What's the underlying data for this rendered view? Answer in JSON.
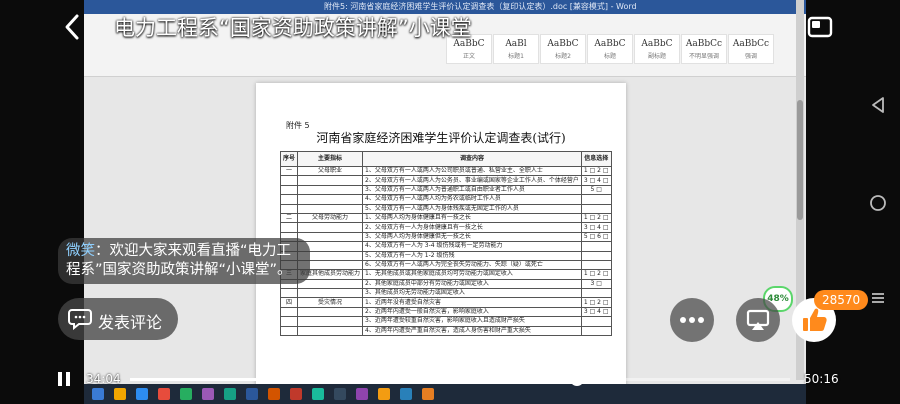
{
  "header": {
    "title": "电力工程系“国家资助政策讲解”小课堂"
  },
  "word": {
    "window_title": "附件5: 河南省家庭经济困难学生评价认定调查表（复印认定表）.doc [兼容模式] - Word",
    "styles": [
      {
        "preview": "AaBbC",
        "name": "正文"
      },
      {
        "preview": "AaBl",
        "name": "标题1"
      },
      {
        "preview": "AaBbC",
        "name": "标题2"
      },
      {
        "preview": "AaBbC",
        "name": "标题"
      },
      {
        "preview": "AaBbC",
        "name": "副标题"
      },
      {
        "preview": "AaBbCc",
        "name": "不明显强调"
      },
      {
        "preview": "AaBbCc",
        "name": "强调"
      }
    ],
    "document": {
      "annex_label": "附件 5",
      "title": "河南省家庭经济困难学生评价认定调查表(试行)",
      "columns": {
        "index": "序号",
        "indicator": "主要指标",
        "content": "调查内容",
        "option": "信息选择"
      },
      "rows": [
        {
          "index": "一",
          "indicator": "父母职业",
          "content": "1、父母双方有一人或两人为公司职员或普通、私营业主、全职人士",
          "option": "1 □ 2 □"
        },
        {
          "index": "",
          "indicator": "",
          "content": "2、父母双方有一人或两人为公务员、事业编或国家等企业工作人员、个体经营户",
          "option": "3 □ 4 □"
        },
        {
          "index": "",
          "indicator": "",
          "content": "3、父母双方有一人或两人为普通职工或自由职业者工作人员",
          "option": "5 □"
        },
        {
          "index": "",
          "indicator": "",
          "content": "4、父母双方有一人或两人均为务农或临时工作人员",
          "option": ""
        },
        {
          "index": "",
          "indicator": "",
          "content": "5、父母双方有一人或两人为身体残疾或无固定工作的人员",
          "option": ""
        },
        {
          "index": "二",
          "indicator": "父母劳动能力",
          "content": "1、父母两人均为身体健康且有一技之长",
          "option": "1 □ 2 □"
        },
        {
          "index": "",
          "indicator": "",
          "content": "2、父母双方有一人为身体健康且有一技之长",
          "option": "3 □ 4 □"
        },
        {
          "index": "",
          "indicator": "",
          "content": "3、父母两人均为身体健康但无一技之长",
          "option": "5 □ 6 □"
        },
        {
          "index": "",
          "indicator": "",
          "content": "4、父母双方有一人为 3-4 级伤残或有一定劳动能力",
          "option": ""
        },
        {
          "index": "",
          "indicator": "",
          "content": "5、父母双方有一人为 1-2 级伤残",
          "option": ""
        },
        {
          "index": "",
          "indicator": "",
          "content": "6、父母双方有一人或两人为完全丧失劳动能力、失踪（疑）或死亡",
          "option": ""
        },
        {
          "index": "三",
          "indicator": "家庭其他成员劳动能力",
          "content": "1、无其他成员或其他家庭成员均可劳动能力或固定收入",
          "option": "1 □ 2 □"
        },
        {
          "index": "",
          "indicator": "",
          "content": "2、其他家庭成员中部分有劳动能力或固定收入",
          "option": "3 □"
        },
        {
          "index": "",
          "indicator": "",
          "content": "3、其他成员均无劳动能力或固定收入",
          "option": ""
        },
        {
          "index": "四",
          "indicator": "受灾情况",
          "content": "1、近两年没有遭受自然灾害",
          "option": "1 □ 2 □"
        },
        {
          "index": "",
          "indicator": "",
          "content": "2、近两年内遭受一般自然灾害，影响家庭收入",
          "option": "3 □ 4 □"
        },
        {
          "index": "",
          "indicator": "",
          "content": "3、近两年遭受较重自然灾害，影响家庭收入且造成财产损失",
          "option": ""
        },
        {
          "index": "",
          "indicator": "",
          "content": "4、近两年内遭受严重自然灾害，造成人身伤害和财产重大损失",
          "option": ""
        }
      ]
    }
  },
  "chat": {
    "user": "微笑",
    "message": "：欢迎大家来观看直播“电力工程系”国家资助政策讲解“小课堂”。"
  },
  "comment": {
    "label": "发表评论"
  },
  "signal": {
    "value": "48%"
  },
  "likes": {
    "count": "28570"
  },
  "player": {
    "current": "34:04",
    "total": "50:16",
    "progress": 0.678
  },
  "colors": {
    "accent": "#ff8a1c",
    "chat_user": "#8fd0ff",
    "word_blue": "#2b579a"
  }
}
